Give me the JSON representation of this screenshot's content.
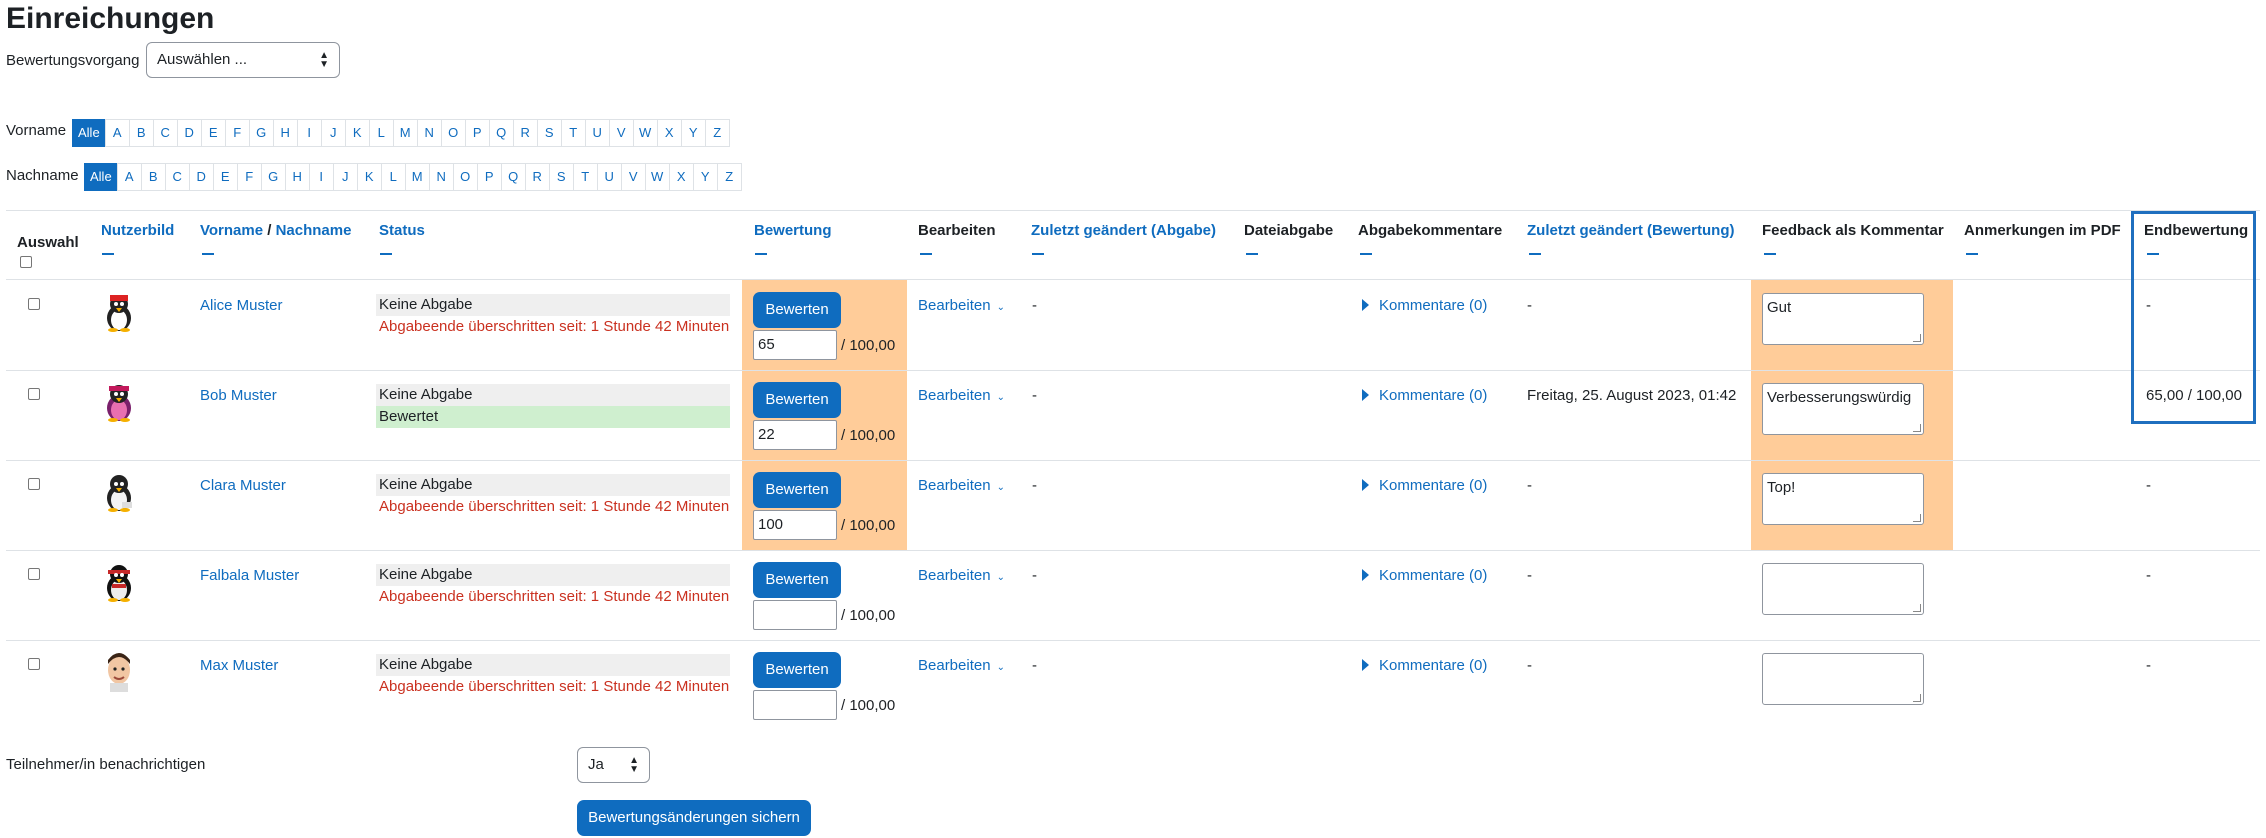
{
  "page": {
    "title": "Einreichungen",
    "workflow_label": "Bewertungsvorgang",
    "workflow_select": "Auswählen ...",
    "firstname_label": "Vorname",
    "lastname_label": "Nachname",
    "letters": [
      "Alle",
      "A",
      "B",
      "C",
      "D",
      "E",
      "F",
      "G",
      "H",
      "I",
      "J",
      "K",
      "L",
      "M",
      "N",
      "O",
      "P",
      "Q",
      "R",
      "S",
      "T",
      "U",
      "V",
      "W",
      "X",
      "Y",
      "Z"
    ]
  },
  "table": {
    "headers": {
      "select": "Auswahl",
      "picture": "Nutzerbild",
      "firstname": "Vorname",
      "slash": "/",
      "lastname": "Nachname",
      "status": "Status",
      "grade": "Bewertung",
      "edit": "Bearbeiten",
      "modified_submission": "Zuletzt geändert (Abgabe)",
      "file_submission": "Dateiabgabe",
      "submission_comments": "Abgabekommentare",
      "modified_grade": "Zuletzt geändert (Bewertung)",
      "feedback_comments": "Feedback als Kommentar",
      "pdf_annotations": "Anmerkungen im PDF",
      "final_grade": "Endbewertung"
    },
    "rows": [
      {
        "name": "Alice Muster",
        "status": "Keine Abgabe",
        "status2": "Abgabeende überschritten seit: 1 Stunde 42 Minuten",
        "grade_button": "Bewerten",
        "grade": "65",
        "out_of": "/ 100,00",
        "edit": "Bearbeiten",
        "modified": "-",
        "comments": "Kommentare (0)",
        "grade_modified": "-",
        "feedback": "Gut",
        "final": "-"
      },
      {
        "name": "Bob Muster",
        "status": "Keine Abgabe",
        "status2": "Bewertet",
        "grade_button": "Bewerten",
        "grade": "22",
        "out_of": "/ 100,00",
        "edit": "Bearbeiten",
        "modified": "-",
        "comments": "Kommentare (0)",
        "grade_modified": "Freitag, 25. August 2023, 01:42",
        "feedback": "Verbesserungswürdig",
        "final": "65,00 / 100,00"
      },
      {
        "name": "Clara Muster",
        "status": "Keine Abgabe",
        "status2": "Abgabeende überschritten seit: 1 Stunde 42 Minuten",
        "grade_button": "Bewerten",
        "grade": "100",
        "out_of": "/ 100,00",
        "edit": "Bearbeiten",
        "modified": "-",
        "comments": "Kommentare (0)",
        "grade_modified": "-",
        "feedback": "Top!",
        "final": "-"
      },
      {
        "name": "Falbala Muster",
        "status": "Keine Abgabe",
        "status2": "Abgabeende überschritten seit: 1 Stunde 42 Minuten",
        "grade_button": "Bewerten",
        "grade": "",
        "out_of": "/ 100,00",
        "edit": "Bearbeiten",
        "modified": "-",
        "comments": "Kommentare (0)",
        "grade_modified": "-",
        "feedback": "",
        "final": "-"
      },
      {
        "name": "Max Muster",
        "status": "Keine Abgabe",
        "status2": "Abgabeende überschritten seit: 1 Stunde 42 Minuten",
        "grade_button": "Bewerten",
        "grade": "",
        "out_of": "/ 100,00",
        "edit": "Bearbeiten",
        "modified": "-",
        "comments": "Kommentare (0)",
        "grade_modified": "-",
        "feedback": "",
        "final": "-"
      }
    ]
  },
  "footer": {
    "notify_label": "Teilnehmer/in benachrichtigen",
    "notify_value": "Ja",
    "save_button": "Bewertungsänderungen sichern"
  },
  "colors": {
    "link": "#0f6cbf",
    "late": "#ca3120",
    "edited_cell": "#ffcc99",
    "graded": "#cfefcf"
  }
}
